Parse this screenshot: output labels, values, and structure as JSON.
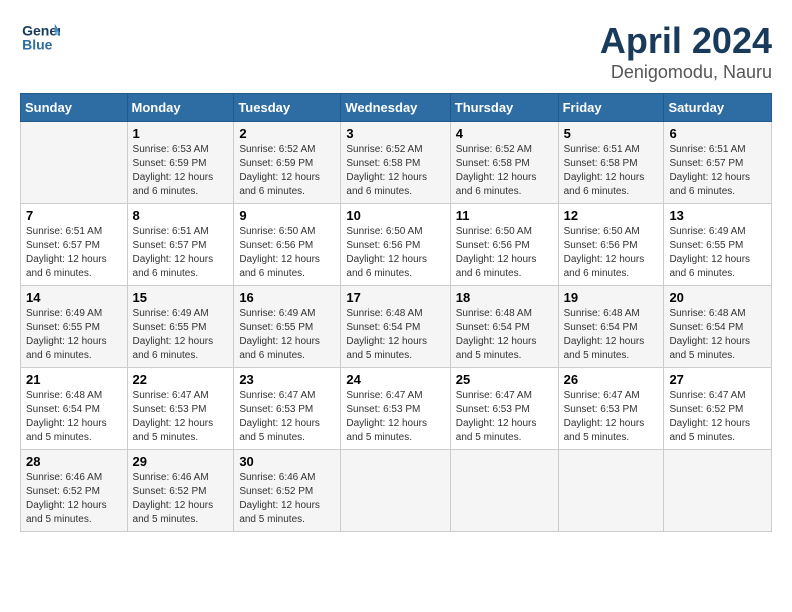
{
  "header": {
    "logo_text_general": "General",
    "logo_text_blue": "Blue",
    "month_title": "April 2024",
    "location": "Denigomod u, Nauru",
    "location_display": "Denigomodu, Nauru"
  },
  "days_of_week": [
    "Sunday",
    "Monday",
    "Tuesday",
    "Wednesday",
    "Thursday",
    "Friday",
    "Saturday"
  ],
  "weeks": [
    [
      {
        "day": "",
        "info": ""
      },
      {
        "day": "1",
        "info": "Sunrise: 6:53 AM\nSunset: 6:59 PM\nDaylight: 12 hours\nand 6 minutes."
      },
      {
        "day": "2",
        "info": "Sunrise: 6:52 AM\nSunset: 6:59 PM\nDaylight: 12 hours\nand 6 minutes."
      },
      {
        "day": "3",
        "info": "Sunrise: 6:52 AM\nSunset: 6:58 PM\nDaylight: 12 hours\nand 6 minutes."
      },
      {
        "day": "4",
        "info": "Sunrise: 6:52 AM\nSunset: 6:58 PM\nDaylight: 12 hours\nand 6 minutes."
      },
      {
        "day": "5",
        "info": "Sunrise: 6:51 AM\nSunset: 6:58 PM\nDaylight: 12 hours\nand 6 minutes."
      },
      {
        "day": "6",
        "info": "Sunrise: 6:51 AM\nSunset: 6:57 PM\nDaylight: 12 hours\nand 6 minutes."
      }
    ],
    [
      {
        "day": "7",
        "info": "Sunrise: 6:51 AM\nSunset: 6:57 PM\nDaylight: 12 hours\nand 6 minutes."
      },
      {
        "day": "8",
        "info": "Sunrise: 6:51 AM\nSunset: 6:57 PM\nDaylight: 12 hours\nand 6 minutes."
      },
      {
        "day": "9",
        "info": "Sunrise: 6:50 AM\nSunset: 6:56 PM\nDaylight: 12 hours\nand 6 minutes."
      },
      {
        "day": "10",
        "info": "Sunrise: 6:50 AM\nSunset: 6:56 PM\nDaylight: 12 hours\nand 6 minutes."
      },
      {
        "day": "11",
        "info": "Sunrise: 6:50 AM\nSunset: 6:56 PM\nDaylight: 12 hours\nand 6 minutes."
      },
      {
        "day": "12",
        "info": "Sunrise: 6:50 AM\nSunset: 6:56 PM\nDaylight: 12 hours\nand 6 minutes."
      },
      {
        "day": "13",
        "info": "Sunrise: 6:49 AM\nSunset: 6:55 PM\nDaylight: 12 hours\nand 6 minutes."
      }
    ],
    [
      {
        "day": "14",
        "info": "Sunrise: 6:49 AM\nSunset: 6:55 PM\nDaylight: 12 hours\nand 6 minutes."
      },
      {
        "day": "15",
        "info": "Sunrise: 6:49 AM\nSunset: 6:55 PM\nDaylight: 12 hours\nand 6 minutes."
      },
      {
        "day": "16",
        "info": "Sunrise: 6:49 AM\nSunset: 6:55 PM\nDaylight: 12 hours\nand 6 minutes."
      },
      {
        "day": "17",
        "info": "Sunrise: 6:48 AM\nSunset: 6:54 PM\nDaylight: 12 hours\nand 5 minutes."
      },
      {
        "day": "18",
        "info": "Sunrise: 6:48 AM\nSunset: 6:54 PM\nDaylight: 12 hours\nand 5 minutes."
      },
      {
        "day": "19",
        "info": "Sunrise: 6:48 AM\nSunset: 6:54 PM\nDaylight: 12 hours\nand 5 minutes."
      },
      {
        "day": "20",
        "info": "Sunrise: 6:48 AM\nSunset: 6:54 PM\nDaylight: 12 hours\nand 5 minutes."
      }
    ],
    [
      {
        "day": "21",
        "info": "Sunrise: 6:48 AM\nSunset: 6:54 PM\nDaylight: 12 hours\nand 5 minutes."
      },
      {
        "day": "22",
        "info": "Sunrise: 6:47 AM\nSunset: 6:53 PM\nDaylight: 12 hours\nand 5 minutes."
      },
      {
        "day": "23",
        "info": "Sunrise: 6:47 AM\nSunset: 6:53 PM\nDaylight: 12 hours\nand 5 minutes."
      },
      {
        "day": "24",
        "info": "Sunrise: 6:47 AM\nSunset: 6:53 PM\nDaylight: 12 hours\nand 5 minutes."
      },
      {
        "day": "25",
        "info": "Sunrise: 6:47 AM\nSunset: 6:53 PM\nDaylight: 12 hours\nand 5 minutes."
      },
      {
        "day": "26",
        "info": "Sunrise: 6:47 AM\nSunset: 6:53 PM\nDaylight: 12 hours\nand 5 minutes."
      },
      {
        "day": "27",
        "info": "Sunrise: 6:47 AM\nSunset: 6:52 PM\nDaylight: 12 hours\nand 5 minutes."
      }
    ],
    [
      {
        "day": "28",
        "info": "Sunrise: 6:46 AM\nSunset: 6:52 PM\nDaylight: 12 hours\nand 5 minutes."
      },
      {
        "day": "29",
        "info": "Sunrise: 6:46 AM\nSunset: 6:52 PM\nDaylight: 12 hours\nand 5 minutes."
      },
      {
        "day": "30",
        "info": "Sunrise: 6:46 AM\nSunset: 6:52 PM\nDaylight: 12 hours\nand 5 minutes."
      },
      {
        "day": "",
        "info": ""
      },
      {
        "day": "",
        "info": ""
      },
      {
        "day": "",
        "info": ""
      },
      {
        "day": "",
        "info": ""
      }
    ]
  ]
}
